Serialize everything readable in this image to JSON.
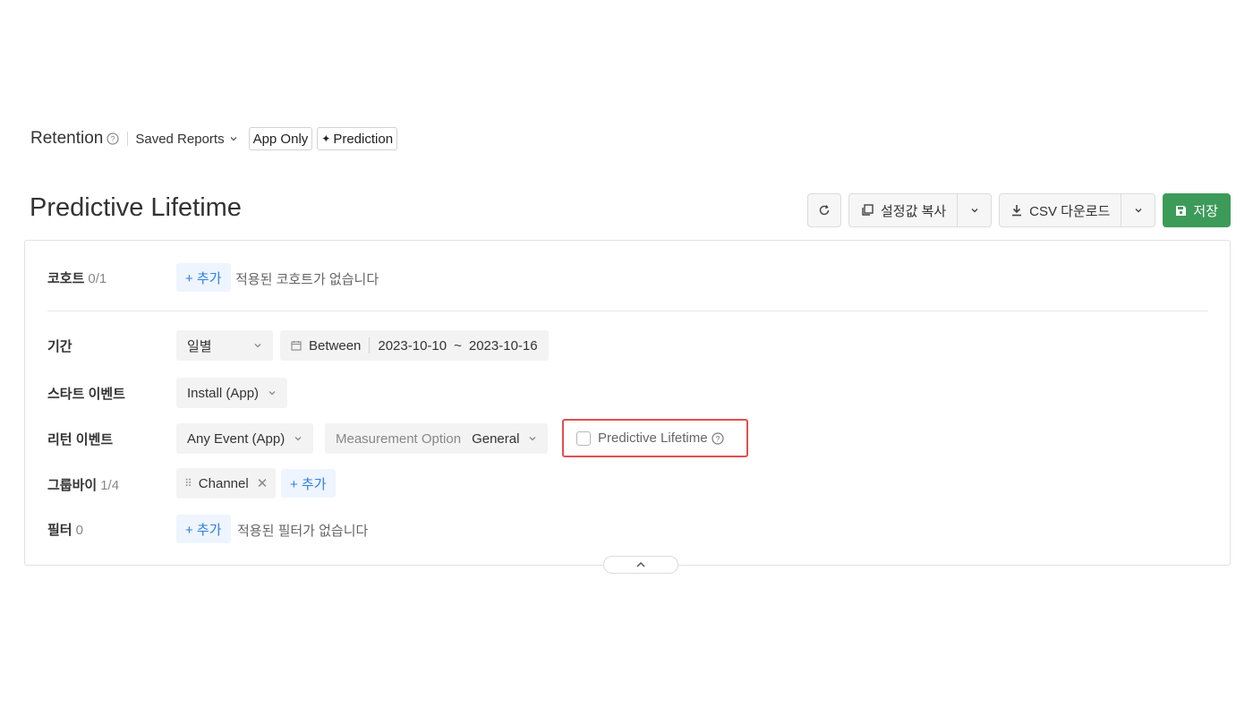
{
  "nav": {
    "title": "Retention",
    "saved_reports": "Saved Reports",
    "app_only": "App Only",
    "prediction": "Prediction"
  },
  "header": {
    "title": "Predictive Lifetime",
    "copy_settings": "설정값 복사",
    "csv_download": "CSV 다운로드",
    "save": "저장"
  },
  "filters": {
    "cohort": {
      "label": "코호트",
      "count": "0/1",
      "add": "+ 추가",
      "empty": "적용된 코호트가 없습니다"
    },
    "period": {
      "label": "기간",
      "granularity": "일별",
      "mode": "Between",
      "start": "2023-10-10",
      "separator": "~",
      "end": "2023-10-16"
    },
    "start_event": {
      "label": "스타트 이벤트",
      "value": "Install (App)"
    },
    "return_event": {
      "label": "리턴 이벤트",
      "value": "Any Event (App)",
      "measurement_label": "Measurement Option",
      "measurement_value": "General",
      "predictive_lifetime": "Predictive Lifetime",
      "predictive_checked": false
    },
    "group_by": {
      "label": "그룹바이",
      "count": "1/4",
      "chip": "Channel",
      "add": "+ 추가"
    },
    "filter": {
      "label": "필터",
      "count": "0",
      "add": "+ 추가",
      "empty": "적용된 필터가 없습니다"
    }
  },
  "colors": {
    "accent": "#2d7fe0",
    "save_green": "#3d9b5a",
    "highlight": "#e04f4f"
  }
}
